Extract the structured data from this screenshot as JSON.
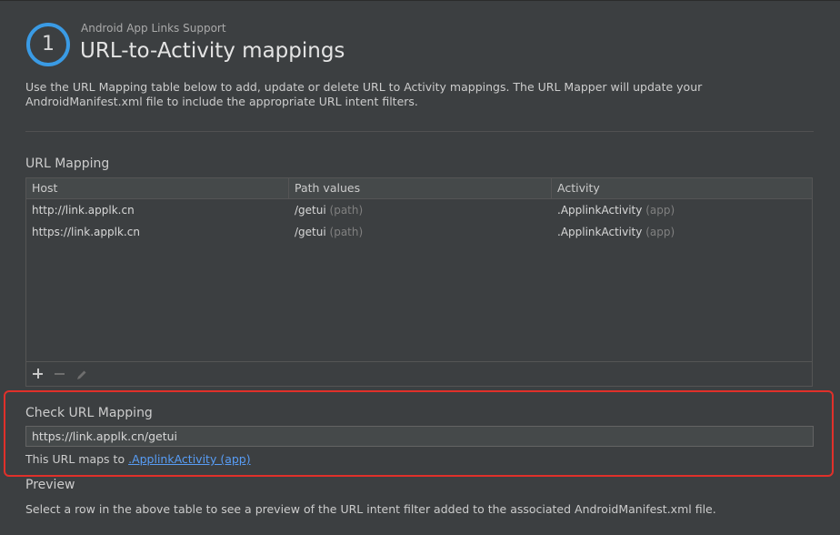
{
  "header": {
    "step_number": "1",
    "subtitle": "Android App Links Support",
    "title": "URL-to-Activity mappings",
    "description": "Use the URL Mapping table below to add, update or delete URL to Activity mappings. The URL Mapper will update your AndroidManifest.xml file to include the appropriate URL intent filters."
  },
  "url_mapping": {
    "label": "URL Mapping",
    "columns": [
      "Host",
      "Path values",
      "Activity"
    ],
    "rows": [
      {
        "host": "http://link.applk.cn",
        "path": "/getui",
        "path_hint": "(path)",
        "activity": ".ApplinkActivity",
        "activity_module": "(app)"
      },
      {
        "host": "https://link.applk.cn",
        "path": "/getui",
        "path_hint": "(path)",
        "activity": ".ApplinkActivity",
        "activity_module": "(app)"
      }
    ],
    "toolbar": {
      "add_icon": "plus-icon",
      "remove_icon": "minus-icon",
      "edit_icon": "pencil-icon"
    }
  },
  "check_url": {
    "label": "Check URL Mapping",
    "value": "https://link.applk.cn/getui",
    "result_prefix": "This URL maps to",
    "result_link": ".ApplinkActivity (app)"
  },
  "preview": {
    "label": "Preview",
    "description": "Select a row in the above table to see a preview of the URL intent filter added to the associated AndroidManifest.xml file."
  },
  "colors": {
    "background": "#3c3f41",
    "accent": "#3a9be5",
    "link": "#589df6",
    "highlight_border": "#e0302a"
  }
}
